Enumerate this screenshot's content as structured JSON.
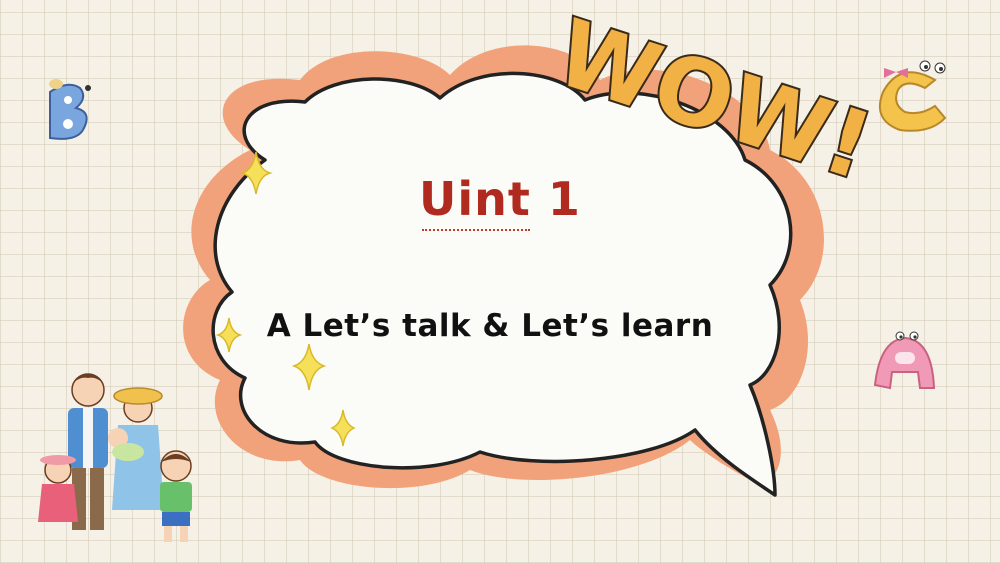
{
  "slide": {
    "title": "Uint 1",
    "subtitle": "A Let’s talk & Let’s learn",
    "wow_text": "WOW!",
    "letters": [
      "B",
      "C",
      "A"
    ]
  },
  "colors": {
    "title": "#b02a20",
    "bubble_fill": "#fbfcf8",
    "bubble_outline": "#f2a27a",
    "wow_fill": "#f2b144",
    "sparkle": "#f6e05a"
  },
  "icons": [
    "sparkle-icon",
    "letter-b-character",
    "letter-c-character",
    "letter-a-character",
    "family-illustration"
  ]
}
